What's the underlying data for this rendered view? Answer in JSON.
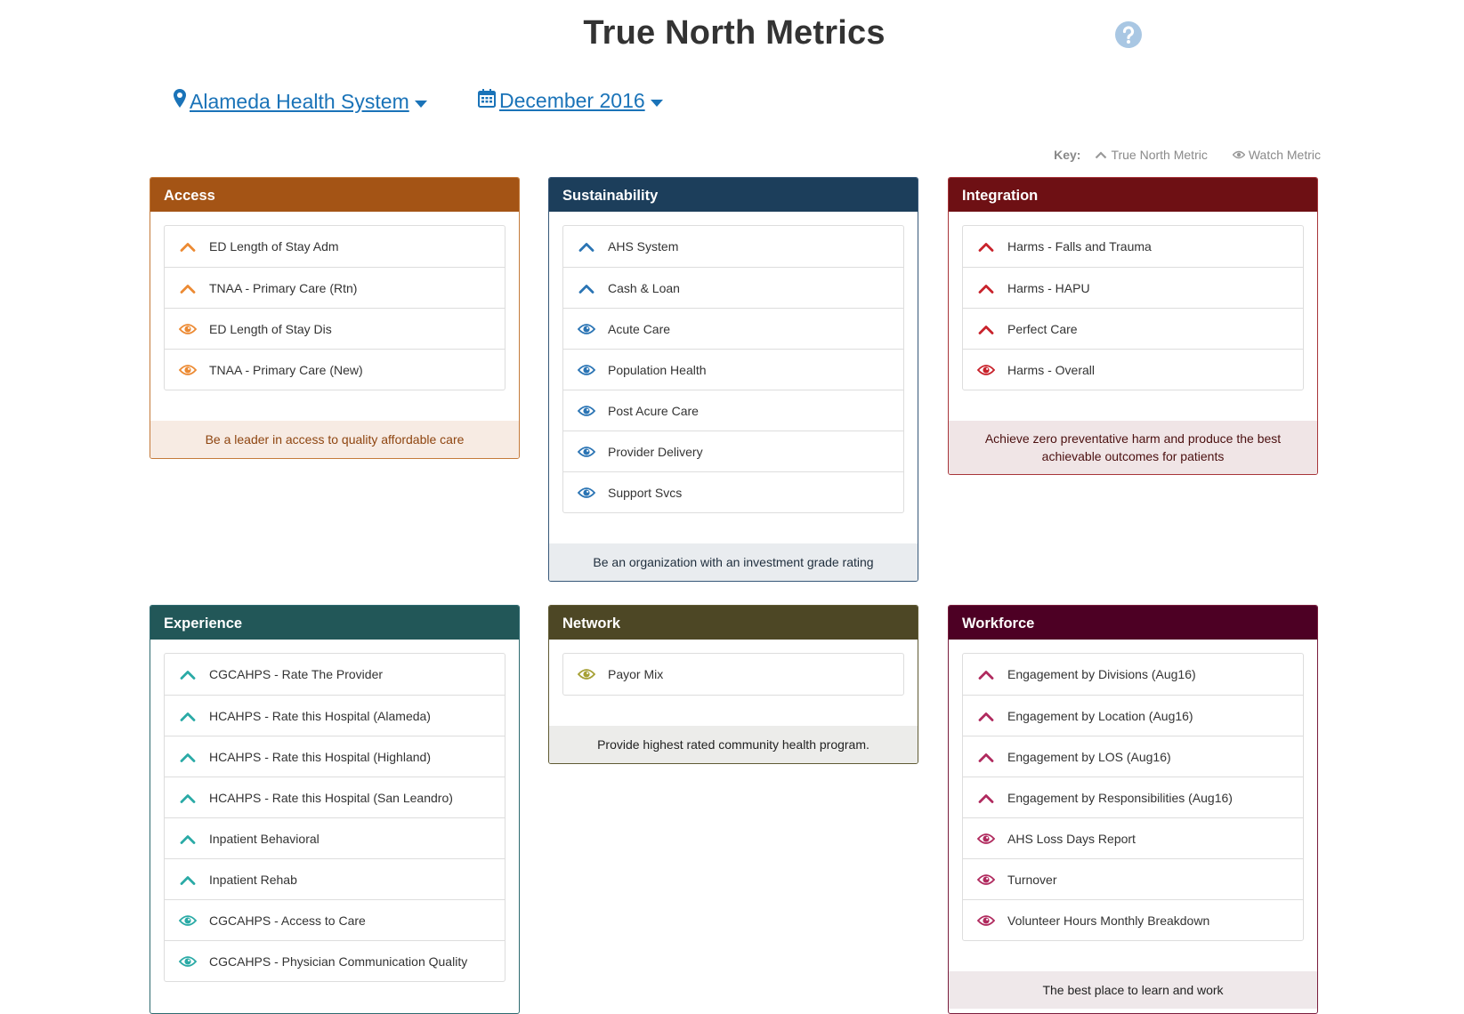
{
  "page": {
    "title": "True North Metrics",
    "help_icon": "question-circle-icon",
    "location": {
      "icon": "map-marker-icon",
      "label": "Alameda Health System"
    },
    "period": {
      "icon": "calendar-icon",
      "label": "December 2016"
    },
    "key": {
      "label": "Key:",
      "true_north": "True North Metric",
      "watch": "Watch Metric"
    }
  },
  "colors": {
    "link": "#1a73b8",
    "access": "#a45415",
    "sustainability": "#1c3e5b",
    "integration": "#6e1014",
    "experience": "#225758",
    "network": "#4d4725",
    "workforce": "#4d0024"
  },
  "panels": {
    "access": {
      "title": "Access",
      "footer": "Be a leader in access to quality affordable care",
      "items": [
        {
          "label": "ED Length of Stay Adm",
          "kind": "true-north"
        },
        {
          "label": "TNAA - Primary Care (Rtn)",
          "kind": "true-north"
        },
        {
          "label": "ED Length of Stay Dis",
          "kind": "watch"
        },
        {
          "label": "TNAA - Primary Care (New)",
          "kind": "watch"
        }
      ]
    },
    "sustainability": {
      "title": "Sustainability",
      "footer": "Be an organization with an investment grade rating",
      "items": [
        {
          "label": "AHS System",
          "kind": "true-north"
        },
        {
          "label": "Cash & Loan",
          "kind": "true-north"
        },
        {
          "label": "Acute Care",
          "kind": "watch"
        },
        {
          "label": "Population Health",
          "kind": "watch"
        },
        {
          "label": "Post Acure Care",
          "kind": "watch"
        },
        {
          "label": "Provider Delivery",
          "kind": "watch"
        },
        {
          "label": "Support Svcs",
          "kind": "watch"
        }
      ]
    },
    "integration": {
      "title": "Integration",
      "footer": "Achieve zero preventative harm and produce the best achievable outcomes for patients",
      "items": [
        {
          "label": "Harms - Falls and Trauma",
          "kind": "true-north"
        },
        {
          "label": "Harms - HAPU",
          "kind": "true-north"
        },
        {
          "label": "Perfect Care",
          "kind": "true-north"
        },
        {
          "label": "Harms - Overall",
          "kind": "watch"
        }
      ]
    },
    "experience": {
      "title": "Experience",
      "items": [
        {
          "label": "CGCAHPS - Rate The Provider",
          "kind": "true-north"
        },
        {
          "label": "HCAHPS - Rate this Hospital (Alameda)",
          "kind": "true-north"
        },
        {
          "label": "HCAHPS - Rate this Hospital (Highland)",
          "kind": "true-north"
        },
        {
          "label": "HCAHPS - Rate this Hospital (San Leandro)",
          "kind": "true-north"
        },
        {
          "label": "Inpatient Behavioral",
          "kind": "true-north"
        },
        {
          "label": "Inpatient Rehab",
          "kind": "true-north"
        },
        {
          "label": "CGCAHPS - Access to Care",
          "kind": "watch"
        },
        {
          "label": "CGCAHPS - Physician Communication Quality",
          "kind": "watch"
        }
      ]
    },
    "network": {
      "title": "Network",
      "footer": "Provide highest rated community health program.",
      "items": [
        {
          "label": "Payor Mix",
          "kind": "watch"
        }
      ]
    },
    "workforce": {
      "title": "Workforce",
      "footer": "The best place to learn and work",
      "items": [
        {
          "label": "Engagement by Divisions (Aug16)",
          "kind": "true-north"
        },
        {
          "label": "Engagement by Location (Aug16)",
          "kind": "true-north"
        },
        {
          "label": "Engagement by LOS (Aug16)",
          "kind": "true-north"
        },
        {
          "label": "Engagement by Responsibilities (Aug16)",
          "kind": "true-north"
        },
        {
          "label": "AHS Loss Days Report",
          "kind": "watch"
        },
        {
          "label": "Turnover",
          "kind": "watch"
        },
        {
          "label": "Volunteer Hours Monthly Breakdown",
          "kind": "watch"
        }
      ]
    }
  }
}
